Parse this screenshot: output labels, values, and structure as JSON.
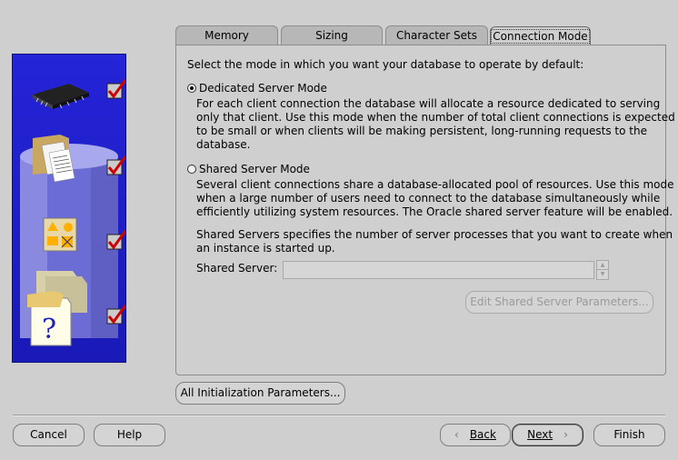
{
  "tabs": [
    {
      "label": "Memory"
    },
    {
      "label": "Sizing"
    },
    {
      "label": "Character Sets"
    },
    {
      "label": "Connection Mode",
      "active": true
    }
  ],
  "panel": {
    "intro": "Select the mode in which you want your database to operate by default:",
    "dedicated": {
      "label": "Dedicated Server Mode",
      "selected": true,
      "description": [
        "For each client connection the database will allocate a resource dedicated to serving",
        "only that client.  Use this mode when the number of total client connections is expected",
        "to be small or when clients will be making persistent, long-running requests to the",
        "database."
      ]
    },
    "shared": {
      "label": "Shared Server Mode",
      "selected": false,
      "description": [
        "Several client connections share a database-allocated pool of resources.  Use this mode",
        "when a large number of users need to connect to the database simultaneously while",
        "efficiently utilizing system resources.  The Oracle shared server feature will be enabled."
      ],
      "servers_note": [
        "Shared Servers specifies the number of server processes that you want to create when",
        "an instance is started up."
      ],
      "field_label": "Shared Server:",
      "field_value": "",
      "edit_button": "Edit Shared Server Parameters..."
    }
  },
  "all_params_button": "All Initialization Parameters...",
  "footer": {
    "cancel": "Cancel",
    "help": "Help",
    "back": "Back",
    "next": "Next",
    "finish": "Finish"
  },
  "colors": {
    "background": "#cfcfcf",
    "art_blue": "#1f1fcf",
    "check_red": "#d00000"
  }
}
